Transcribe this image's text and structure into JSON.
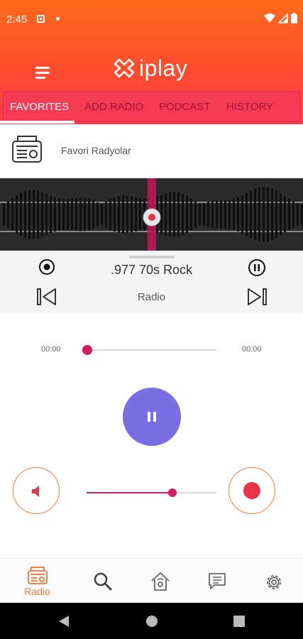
{
  "status": {
    "time": "2:45"
  },
  "app": {
    "logo_text": "iplay"
  },
  "tabs": [
    {
      "label": "FAVORITES",
      "active": true
    },
    {
      "label": "ADD RADIO",
      "active": false
    },
    {
      "label": "PODCAST",
      "active": false
    },
    {
      "label": "HISTORY",
      "active": false
    }
  ],
  "favorites_row": {
    "label": "Favori Radyolar",
    "icon": "radio-icon"
  },
  "player_bar": {
    "station_name": ".977 70s Rock",
    "station_type": "Radio"
  },
  "player": {
    "current_time": "00:00",
    "total_time": "00:00",
    "seek_progress": 0,
    "volume_level": 0.66
  },
  "bottom_nav": [
    {
      "label": "Radio",
      "icon": "radio-icon",
      "active": true
    },
    {
      "label": "",
      "icon": "search-icon",
      "active": false
    },
    {
      "label": "",
      "icon": "home-icon",
      "active": false
    },
    {
      "label": "",
      "icon": "chat-icon",
      "active": false
    },
    {
      "label": "",
      "icon": "gear-icon",
      "active": false
    }
  ],
  "colors": {
    "header_top": "#ff6a1a",
    "header_bottom": "#f83a4a",
    "accent": "#d81b60",
    "play_button": "#7b6ee4",
    "orange": "#ff7a3d"
  }
}
